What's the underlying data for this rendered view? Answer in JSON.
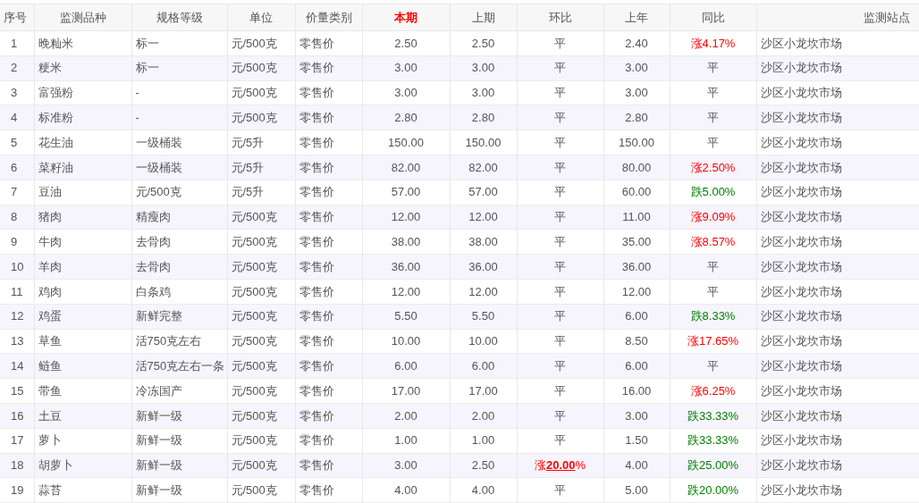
{
  "table": {
    "columns": [
      {
        "label": "序号",
        "highlight": false
      },
      {
        "label": "监测品种",
        "highlight": false
      },
      {
        "label": "规格等级",
        "highlight": false
      },
      {
        "label": "单位",
        "highlight": false
      },
      {
        "label": "价量类别",
        "highlight": false
      },
      {
        "label": "本期",
        "highlight": true
      },
      {
        "label": "上期",
        "highlight": false
      },
      {
        "label": "环比",
        "highlight": false
      },
      {
        "label": "上年",
        "highlight": false
      },
      {
        "label": "同比",
        "highlight": false
      },
      {
        "label": "监测站点",
        "highlight": false
      }
    ],
    "rows": [
      {
        "no": "1",
        "item": "晚籼米",
        "grade": "标一",
        "unit": "元/500克",
        "type": "零售价",
        "current": "2.50",
        "previous": "2.50",
        "mom": {
          "text": "平"
        },
        "last_year": "2.40",
        "yoy": {
          "color": "#ff0000",
          "text": "涨4.17%"
        },
        "site": "沙区小龙坎市场"
      },
      {
        "no": "2",
        "item": "粳米",
        "grade": "标一",
        "unit": "元/500克",
        "type": "零售价",
        "current": "3.00",
        "previous": "3.00",
        "mom": {
          "text": "平"
        },
        "last_year": "3.00",
        "yoy": {
          "text": "平"
        },
        "site": "沙区小龙坎市场"
      },
      {
        "no": "3",
        "item": "富强粉",
        "grade": "-",
        "unit": "元/500克",
        "type": "零售价",
        "current": "3.00",
        "previous": "3.00",
        "mom": {
          "text": "平"
        },
        "last_year": "3.00",
        "yoy": {
          "text": "平"
        },
        "site": "沙区小龙坎市场"
      },
      {
        "no": "4",
        "item": "标准粉",
        "grade": "-",
        "unit": "元/500克",
        "type": "零售价",
        "current": "2.80",
        "previous": "2.80",
        "mom": {
          "text": "平"
        },
        "last_year": "2.80",
        "yoy": {
          "text": "平"
        },
        "site": "沙区小龙坎市场"
      },
      {
        "no": "5",
        "item": "花生油",
        "grade": "一级桶装",
        "unit": "元/5升",
        "type": "零售价",
        "current": "150.00",
        "previous": "150.00",
        "mom": {
          "text": "平"
        },
        "last_year": "150.00",
        "yoy": {
          "text": "平"
        },
        "site": "沙区小龙坎市场"
      },
      {
        "no": "6",
        "item": "菜籽油",
        "grade": "一级桶装",
        "unit": "元/5升",
        "type": "零售价",
        "current": "82.00",
        "previous": "82.00",
        "mom": {
          "text": "平"
        },
        "last_year": "80.00",
        "yoy": {
          "color": "#ff0000",
          "text": "涨2.50%"
        },
        "site": "沙区小龙坎市场"
      },
      {
        "no": "7",
        "item": "豆油",
        "grade": "元/500克",
        "unit": "元/5升",
        "type": "零售价",
        "current": "57.00",
        "previous": "57.00",
        "mom": {
          "text": "平"
        },
        "last_year": "60.00",
        "yoy": {
          "color": "#008000",
          "text": "跌5.00%"
        },
        "site": "沙区小龙坎市场"
      },
      {
        "no": "8",
        "item": "猪肉",
        "grade": "精瘦肉",
        "unit": "元/500克",
        "type": "零售价",
        "current": "12.00",
        "previous": "12.00",
        "mom": {
          "text": "平"
        },
        "last_year": "11.00",
        "yoy": {
          "color": "#ff0000",
          "text": "涨9.09%"
        },
        "site": "沙区小龙坎市场"
      },
      {
        "no": "9",
        "item": "牛肉",
        "grade": "去骨肉",
        "unit": "元/500克",
        "type": "零售价",
        "current": "38.00",
        "previous": "38.00",
        "mom": {
          "text": "平"
        },
        "last_year": "35.00",
        "yoy": {
          "color": "#ff0000",
          "text": "涨8.57%"
        },
        "site": "沙区小龙坎市场"
      },
      {
        "no": "10",
        "item": "羊肉",
        "grade": "去骨肉",
        "unit": "元/500克",
        "type": "零售价",
        "current": "36.00",
        "previous": "36.00",
        "mom": {
          "text": "平"
        },
        "last_year": "36.00",
        "yoy": {
          "text": "平"
        },
        "site": "沙区小龙坎市场"
      },
      {
        "no": "11",
        "item": "鸡肉",
        "grade": "白条鸡",
        "unit": "元/500克",
        "type": "零售价",
        "current": "12.00",
        "previous": "12.00",
        "mom": {
          "text": "平"
        },
        "last_year": "12.00",
        "yoy": {
          "text": "平"
        },
        "site": "沙区小龙坎市场"
      },
      {
        "no": "12",
        "item": "鸡蛋",
        "grade": "新鲜完整",
        "unit": "元/500克",
        "type": "零售价",
        "current": "5.50",
        "previous": "5.50",
        "mom": {
          "text": "平"
        },
        "last_year": "6.00",
        "yoy": {
          "color": "#008000",
          "text": "跌8.33%"
        },
        "site": "沙区小龙坎市场"
      },
      {
        "no": "13",
        "item": "草鱼",
        "grade": "活750克左右",
        "unit": "元/500克",
        "type": "零售价",
        "current": "10.00",
        "previous": "10.00",
        "mom": {
          "text": "平"
        },
        "last_year": "8.50",
        "yoy": {
          "color": "#ff0000",
          "text": "涨17.65%"
        },
        "site": "沙区小龙坎市场"
      },
      {
        "no": "14",
        "item": "鲢鱼",
        "grade": "活750克左右一条",
        "unit": "元/500克",
        "type": "零售价",
        "current": "6.00",
        "previous": "6.00",
        "mom": {
          "text": "平"
        },
        "last_year": "6.00",
        "yoy": {
          "text": "平"
        },
        "site": "沙区小龙坎市场"
      },
      {
        "no": "15",
        "item": "带鱼",
        "grade": "冷冻国产",
        "unit": "元/500克",
        "type": "零售价",
        "current": "17.00",
        "previous": "17.00",
        "mom": {
          "text": "平"
        },
        "last_year": "16.00",
        "yoy": {
          "color": "#ff0000",
          "text": "涨6.25%"
        },
        "site": "沙区小龙坎市场"
      },
      {
        "no": "16",
        "item": "土豆",
        "grade": "新鲜一级",
        "unit": "元/500克",
        "type": "零售价",
        "current": "2.00",
        "previous": "2.00",
        "mom": {
          "text": "平"
        },
        "last_year": "3.00",
        "yoy": {
          "color": "#008000",
          "text": "跌33.33%"
        },
        "site": "沙区小龙坎市场"
      },
      {
        "no": "17",
        "item": "萝卜",
        "grade": "新鲜一级",
        "unit": "元/500克",
        "type": "零售价",
        "current": "1.00",
        "previous": "1.00",
        "mom": {
          "text": "平"
        },
        "last_year": "1.50",
        "yoy": {
          "color": "#008000",
          "text": "跌33.33%"
        },
        "site": "沙区小龙坎市场"
      },
      {
        "no": "18",
        "item": "胡萝卜",
        "grade": "新鲜一级",
        "unit": "元/500克",
        "type": "零售价",
        "current": "3.00",
        "previous": "2.50",
        "mom": {
          "color": "#ff0000",
          "text": "涨**20.00**%"
        },
        "last_year": "4.00",
        "yoy": {
          "color": "#008000",
          "text": "跌25.00%"
        },
        "site": "沙区小龙坎市场"
      },
      {
        "no": "19",
        "item": "蒜苔",
        "grade": "新鲜一级",
        "unit": "元/500克",
        "type": "零售价",
        "current": "4.00",
        "previous": "4.00",
        "mom": {
          "text": "平"
        },
        "last_year": "5.00",
        "yoy": {
          "color": "#008000",
          "text": "跌20.00%"
        },
        "site": "沙区小龙坎市场"
      }
    ]
  }
}
